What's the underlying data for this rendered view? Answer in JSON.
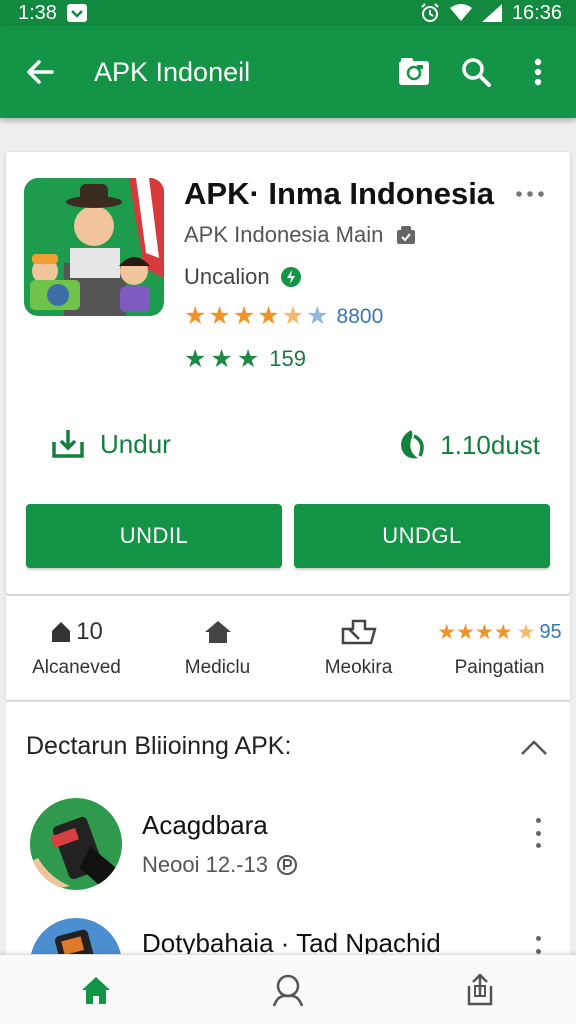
{
  "status_bar": {
    "time_left": "1:38",
    "time_right": "16:36"
  },
  "app_bar": {
    "title": "APK Indoneil"
  },
  "app": {
    "name": "APK· Inma Indonesia",
    "publisher": "APK Indonesia Main",
    "category": "Uncalion",
    "rating_count": "8800",
    "green_count": "159",
    "download_label": "Undur",
    "downloads_text": "1.10dust",
    "button_left": "UNDIL",
    "button_right": "UNDGL"
  },
  "stats": [
    {
      "value": "10",
      "label": "Alcaneved",
      "icon": "home-icon"
    },
    {
      "value": "",
      "label": "Mediclu",
      "icon": "home-icon"
    },
    {
      "value": "",
      "label": "Meokira",
      "icon": "puzzle-icon"
    },
    {
      "value": "95",
      "label": "Paingatian",
      "icon": "stars-icon"
    }
  ],
  "section": {
    "title": "Dectarun Bliioinng APK:",
    "items": [
      {
        "title": "Acagdbara",
        "subtitle": "Neooi 12.-13"
      },
      {
        "title": "Dotybahaia · Tad Npachid",
        "subtitle": ""
      }
    ]
  },
  "colors": {
    "primary": "#149447",
    "status": "#12893f",
    "star_orange": "#f0942a",
    "star_blue": "#8fb6e0",
    "link_blue": "#3a76b5"
  }
}
